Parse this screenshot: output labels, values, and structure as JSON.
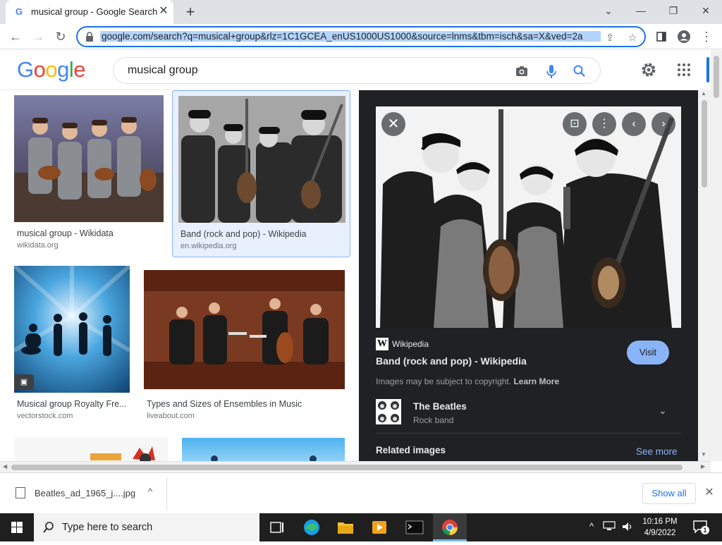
{
  "browser": {
    "tab_title": "musical group - Google Search",
    "tab_favicon": "G",
    "new_tab": "+",
    "url": "google.com/search?q=musical+group&rlz=1C1GCEA_enUS1000US1000&source=lnms&tbm=isch&sa=X&ved=2a",
    "window_controls": {
      "minimize": "—",
      "restore": "❐",
      "close": "✕",
      "tab_search": "⌄"
    }
  },
  "google": {
    "logo_letters": [
      "G",
      "o",
      "o",
      "g",
      "l",
      "e"
    ],
    "logo_colors": [
      "#4285f4",
      "#ea4335",
      "#fbbc05",
      "#4285f4",
      "#34a853",
      "#ea4335"
    ],
    "query": "musical group"
  },
  "results": [
    {
      "caption": "musical group - Wikidata",
      "source": "wikidata.org"
    },
    {
      "caption": "Band (rock and pop) - Wikipedia",
      "source": "en.wikipedia.org"
    },
    {
      "caption": "Musical group Royalty Fre...",
      "source": "vectorstock.com"
    },
    {
      "caption": "Types and Sizes of Ensembles in Music",
      "source": "liveabout.com"
    }
  ],
  "preview": {
    "source_logo": "W",
    "source": "Wikipedia",
    "title": "Band (rock and pop) - Wikipedia",
    "visit": "Visit",
    "copyright": "Images may be subject to copyright.",
    "learn_more": "Learn More",
    "entity_name": "The Beatles",
    "entity_type": "Rock band",
    "related": "Related images",
    "see_more": "See more"
  },
  "downloads": {
    "file": "Beatles_ad_1965_j....jpg",
    "show_all": "Show all"
  },
  "taskbar": {
    "search_placeholder": "Type here to search",
    "time": "10:16 PM",
    "date": "4/9/2022",
    "notification_count": "1"
  },
  "colors": {
    "accent": "#1a73e8",
    "panel_bg": "#202124",
    "visit_button": "#8ab4f8",
    "selected_card_bg": "#e8f0fe"
  }
}
